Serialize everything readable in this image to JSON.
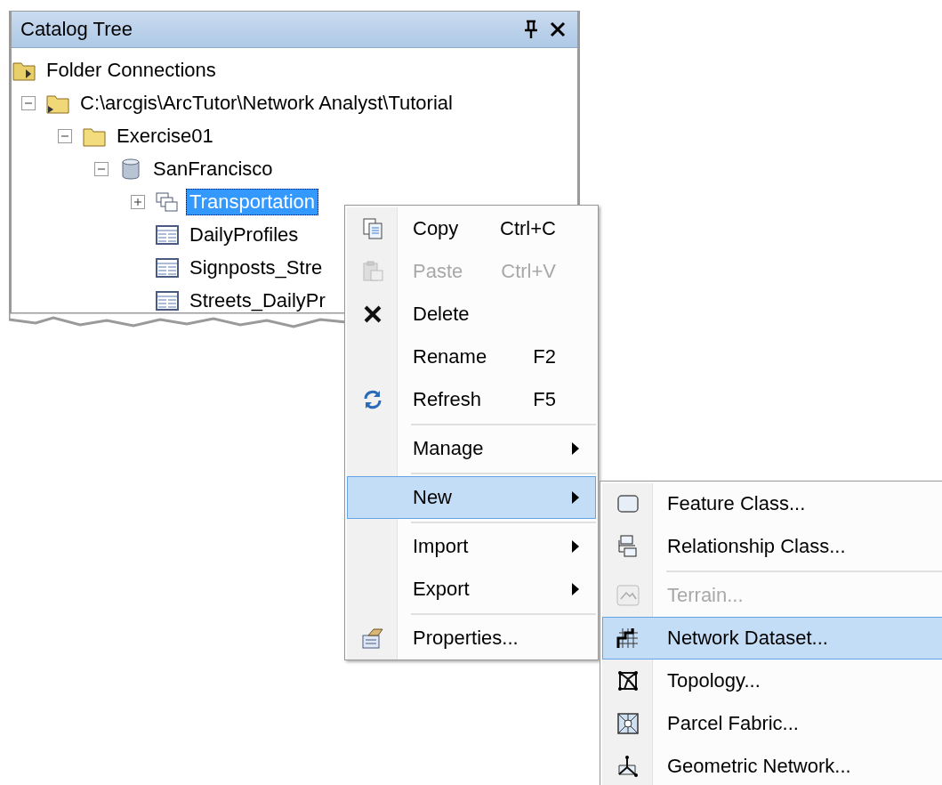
{
  "panel": {
    "title": "Catalog Tree"
  },
  "tree": [
    {
      "label": "Folder Connections",
      "kind": "connections",
      "selected": false
    },
    {
      "label": "C:\\arcgis\\ArcTutor\\Network Analyst\\Tutorial",
      "kind": "folder-link",
      "expanded": true,
      "selected": false,
      "children": [
        {
          "label": "Exercise01",
          "kind": "folder",
          "expanded": true,
          "selected": false,
          "children": [
            {
              "label": "SanFrancisco",
              "kind": "database",
              "expanded": true,
              "selected": false,
              "children": [
                {
                  "label": "Transportation",
                  "kind": "dataset",
                  "expanded": false,
                  "selected": true
                },
                {
                  "label": "DailyProfiles",
                  "kind": "table",
                  "selected": false
                },
                {
                  "label": "Signposts_Stre",
                  "kind": "table",
                  "selected": false
                },
                {
                  "label": "Streets_DailyPr",
                  "kind": "table",
                  "selected": false
                }
              ]
            }
          ]
        }
      ]
    }
  ],
  "context_menu": [
    {
      "kind": "item",
      "label": "Copy",
      "shortcut": "Ctrl+C",
      "disabled": false,
      "submenu": false,
      "selected": false
    },
    {
      "kind": "item",
      "label": "Paste",
      "shortcut": "Ctrl+V",
      "disabled": true,
      "submenu": false,
      "selected": false
    },
    {
      "kind": "item",
      "label": "Delete",
      "disabled": false,
      "submenu": false,
      "selected": false
    },
    {
      "kind": "item",
      "label": "Rename",
      "shortcut": "F2",
      "disabled": false,
      "submenu": false,
      "selected": false
    },
    {
      "kind": "item",
      "label": "Refresh",
      "shortcut": "F5",
      "disabled": false,
      "submenu": false,
      "selected": false
    },
    {
      "kind": "separator"
    },
    {
      "kind": "item",
      "label": "Manage",
      "disabled": false,
      "submenu": true,
      "selected": false
    },
    {
      "kind": "separator"
    },
    {
      "kind": "item",
      "label": "New",
      "disabled": false,
      "submenu": true,
      "selected": true
    },
    {
      "kind": "separator"
    },
    {
      "kind": "item",
      "label": "Import",
      "disabled": false,
      "submenu": true,
      "selected": false
    },
    {
      "kind": "item",
      "label": "Export",
      "disabled": false,
      "submenu": true,
      "selected": false
    },
    {
      "kind": "separator"
    },
    {
      "kind": "item",
      "label": "Properties...",
      "disabled": false,
      "submenu": false,
      "selected": false
    }
  ],
  "new_submenu": [
    {
      "kind": "item",
      "label": "Feature Class...",
      "disabled": false,
      "selected": false
    },
    {
      "kind": "item",
      "label": "Relationship Class...",
      "disabled": false,
      "selected": false
    },
    {
      "kind": "separator"
    },
    {
      "kind": "item",
      "label": "Terrain...",
      "disabled": true,
      "selected": false
    },
    {
      "kind": "item",
      "label": "Network Dataset...",
      "disabled": false,
      "selected": true
    },
    {
      "kind": "item",
      "label": "Topology...",
      "disabled": false,
      "selected": false
    },
    {
      "kind": "item",
      "label": "Parcel Fabric...",
      "disabled": false,
      "selected": false
    },
    {
      "kind": "item",
      "label": "Geometric Network...",
      "disabled": false,
      "selected": false
    }
  ]
}
